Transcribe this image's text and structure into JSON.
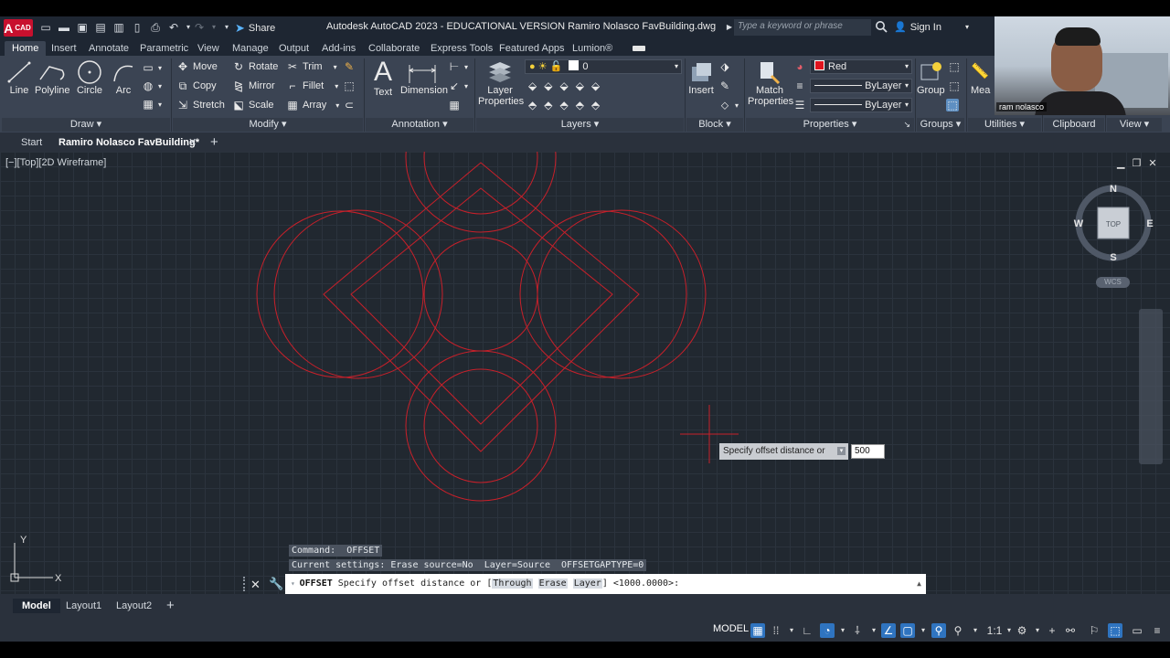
{
  "app": {
    "logo_text": "CAD",
    "window_title": "Autodesk AutoCAD 2023 - EDUCATIONAL VERSION    Ramiro Nolasco FavBuilding.dwg",
    "share_label": "Share",
    "search_placeholder": "Type a keyword or phrase",
    "signin_label": "Sign In"
  },
  "ribbon_tabs": [
    "Home",
    "Insert",
    "Annotate",
    "Parametric",
    "View",
    "Manage",
    "Output",
    "Add-ins",
    "Collaborate",
    "Express Tools",
    "Featured Apps",
    "Lumion®"
  ],
  "ribbon": {
    "draw": {
      "title": "Draw",
      "line": "Line",
      "polyline": "Polyline",
      "circle": "Circle",
      "arc": "Arc"
    },
    "modify": {
      "title": "Modify",
      "move": "Move",
      "rotate": "Rotate",
      "trim": "Trim",
      "copy": "Copy",
      "mirror": "Mirror",
      "fillet": "Fillet",
      "stretch": "Stretch",
      "scale": "Scale",
      "array": "Array"
    },
    "annotation": {
      "title": "Annotation",
      "text": "Text",
      "dimension": "Dimension"
    },
    "layers": {
      "title": "Layers",
      "layer_properties": "Layer Properties",
      "current_layer": "0"
    },
    "block": {
      "title": "Block",
      "insert": "Insert"
    },
    "properties": {
      "title": "Properties",
      "match": "Match Properties",
      "color": "Red",
      "linetype": "ByLayer",
      "lineweight": "ByLayer"
    },
    "groups": {
      "title": "Groups",
      "group": "Group"
    },
    "utilities": {
      "title": "Utilities",
      "measure": "Mea"
    },
    "clipboard": {
      "title": "Clipboard"
    },
    "view": {
      "title": "View"
    }
  },
  "doc_tabs": {
    "start": "Start",
    "active": "Ramiro Nolasco FavBuilding*",
    "add": "+"
  },
  "viewport": {
    "label": "[−][Top][2D Wireframe]",
    "viewcube": {
      "n": "N",
      "s": "S",
      "e": "E",
      "w": "W",
      "face": "TOP"
    },
    "wcs": "WCS",
    "ucs_x": "X",
    "ucs_y": "Y"
  },
  "dynamic_input": {
    "prompt": "Specify offset distance or",
    "value": "500"
  },
  "command_history": [
    "Command:  OFFSET",
    "Current settings: Erase source=No  Layer=Source  OFFSETGAPTYPE=0"
  ],
  "command_line": {
    "command": "OFFSET",
    "prompt_pre": " Specify offset distance or [",
    "options": [
      "Through",
      "Erase",
      "Layer"
    ],
    "prompt_post": "] <1000.0000>:"
  },
  "layout_tabs": [
    "Model",
    "Layout1",
    "Layout2"
  ],
  "status_bar": {
    "model": "MODEL",
    "scale": "1:1"
  },
  "webcam": {
    "name": "ram nolasco"
  },
  "colors": {
    "drawing_lines": "#c8202a",
    "accent": "#2f74c0",
    "canvas": "#212830"
  }
}
